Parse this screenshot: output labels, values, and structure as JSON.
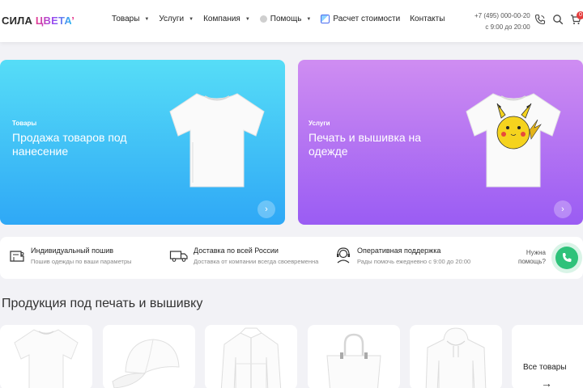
{
  "header": {
    "logo_part1": "СИЛА ",
    "logo_part2": "ЦВЕТА",
    "logo_mark": "’",
    "nav": [
      {
        "label": "Товары"
      },
      {
        "label": "Услуги"
      },
      {
        "label": "Компания"
      },
      {
        "label": "Помощь"
      },
      {
        "label": "Расчет стоимости"
      },
      {
        "label": "Контакты"
      }
    ],
    "phone": "+7 (495) 000-00-20",
    "hours": "с 9:00 до 20:00",
    "cart_count": "0",
    "icons": [
      "phone-icon",
      "search-icon",
      "cart-icon"
    ]
  },
  "hero": [
    {
      "eyebrow": "Товары",
      "title": "Продажа товаров под нанесение",
      "arrow": "›"
    },
    {
      "eyebrow": "Услуги",
      "title": "Печать и вышивка на одежде",
      "arrow": "›"
    }
  ],
  "features": [
    {
      "title": "Индивидуальный пошив",
      "subtitle": "Пошив одежды по ваши параметры",
      "icon": "sewing-machine-icon"
    },
    {
      "title": "Доставка по всей России",
      "subtitle": "Доставка от компании всегда своевременна",
      "icon": "truck-icon"
    },
    {
      "title": "Оперативная поддержка",
      "subtitle": "Рады помочь ежедневно с 9:00 до 20:00",
      "icon": "support-headset-icon"
    }
  ],
  "help": {
    "line1": "Нужна",
    "line2": "помощь?"
  },
  "products": {
    "title": "Продукция под печать и вышивку",
    "items": [
      "tshirt",
      "cap",
      "jacket",
      "bag",
      "hoodie"
    ],
    "all_label": "Все товары",
    "all_arrow": "→"
  },
  "colors": {
    "card_left": "#2fa8f6",
    "card_right": "#9a5cf3",
    "help_green": "#2ec27a"
  }
}
